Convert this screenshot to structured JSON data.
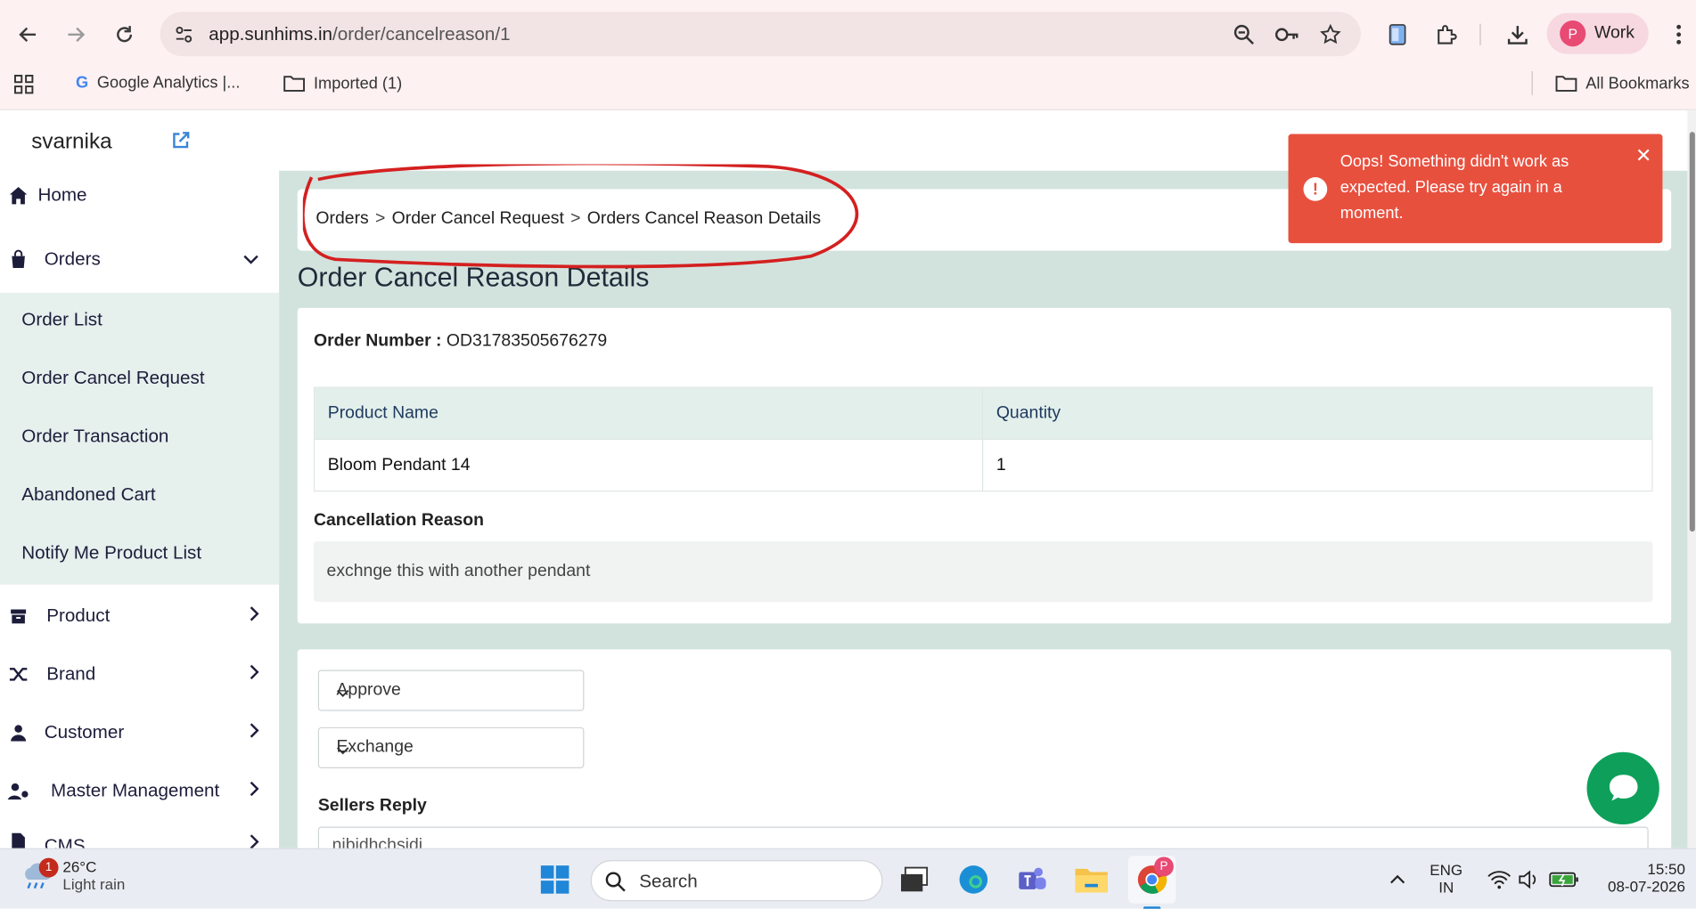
{
  "browser": {
    "url_host": "app.sunhims.in",
    "url_path": "/order/cancelreason/1",
    "profile_initial": "P",
    "profile_name": "Work",
    "bookmarks": [
      {
        "label": "Google Analytics |..."
      },
      {
        "label": "Imported (1)"
      }
    ],
    "all_bookmarks": "All Bookmarks"
  },
  "sidebar": {
    "brand": "svarnika",
    "items": {
      "home": "Home",
      "orders": "Orders",
      "product": "Product",
      "brand": "Brand",
      "customer": "Customer",
      "master": "Master Management",
      "cms": "CMS"
    },
    "orders_submenu": [
      "Order List",
      "Order Cancel Request",
      "Order Transaction",
      "Abandoned Cart",
      "Notify Me Product List"
    ]
  },
  "breadcrumb": {
    "items": [
      "Orders",
      "Order Cancel Request",
      "Orders Cancel Reason Details"
    ],
    "separator": ">"
  },
  "page": {
    "title": "Order Cancel Reason Details",
    "order_number_label": "Order Number :",
    "order_number": "OD31783505676279",
    "table": {
      "headers": [
        "Product Name",
        "Quantity"
      ],
      "rows": [
        [
          "Bloom Pendant 14",
          "1"
        ]
      ]
    },
    "cancellation_label": "Cancellation Reason",
    "cancellation_reason": "exchnge this with another pendant",
    "action_select": "Approve",
    "type_select": "Exchange",
    "sellers_reply_label": "Sellers Reply",
    "sellers_reply_value": "nibidhchsidi"
  },
  "toast": {
    "message": "Oops! Something didn't work as expected. Please try again in a moment.",
    "color": "#e8503e"
  },
  "annotation_color": "#d42020",
  "taskbar": {
    "weather_badge": "1",
    "temperature": "26°C",
    "weather": "Light rain",
    "search_placeholder": "Search",
    "lang_top": "ENG",
    "lang_bottom": "IN",
    "time": "15:50",
    "date": "08-07-2026",
    "chrome_badge": "P"
  }
}
